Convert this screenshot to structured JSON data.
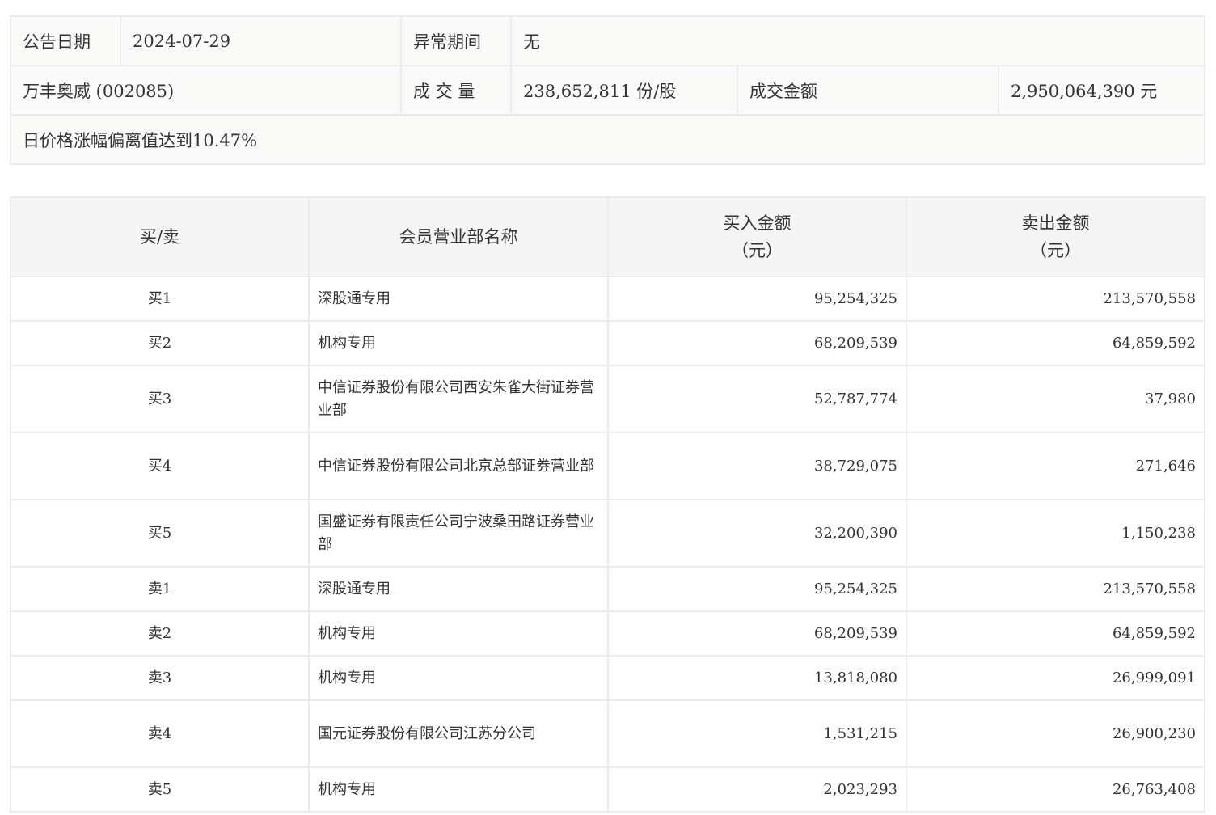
{
  "info": {
    "date_label": "公告日期",
    "date": "2024-07-29",
    "period_label": "异常期间",
    "period": "无",
    "stock": "万丰奥威 (002085)",
    "volume_label": "成 交 量",
    "volume": "238,652,811 份/股",
    "amount_label": "成交金额",
    "amount": "2,950,064,390 元",
    "reason": "日价格涨幅偏离值达到10.47%"
  },
  "table": {
    "headers": {
      "side": "买/卖",
      "member": "会员营业部名称",
      "buy": "买入金额",
      "buy_unit": "（元）",
      "sell": "卖出金额",
      "sell_unit": "（元）"
    },
    "rows": [
      {
        "side": "买1",
        "member": "深股通专用",
        "buy": "95,254,325",
        "sell": "213,570,558"
      },
      {
        "side": "买2",
        "member": "机构专用",
        "buy": "68,209,539",
        "sell": "64,859,592"
      },
      {
        "side": "买3",
        "member": "中信证券股份有限公司西安朱雀大街证券营业部",
        "buy": "52,787,774",
        "sell": "37,980"
      },
      {
        "side": "买4",
        "member": "中信证券股份有限公司北京总部证券营业部",
        "buy": "38,729,075",
        "sell": "271,646"
      },
      {
        "side": "买5",
        "member": "国盛证券有限责任公司宁波桑田路证券营业部",
        "buy": "32,200,390",
        "sell": "1,150,238"
      },
      {
        "side": "卖1",
        "member": "深股通专用",
        "buy": "95,254,325",
        "sell": "213,570,558"
      },
      {
        "side": "卖2",
        "member": "机构专用",
        "buy": "68,209,539",
        "sell": "64,859,592"
      },
      {
        "side": "卖3",
        "member": "机构专用",
        "buy": "13,818,080",
        "sell": "26,999,091"
      },
      {
        "side": "卖4",
        "member": "国元证券股份有限公司江苏分公司",
        "buy": "1,531,215",
        "sell": "26,900,230"
      },
      {
        "side": "卖5",
        "member": "机构专用",
        "buy": "2,023,293",
        "sell": "26,763,408"
      }
    ]
  }
}
